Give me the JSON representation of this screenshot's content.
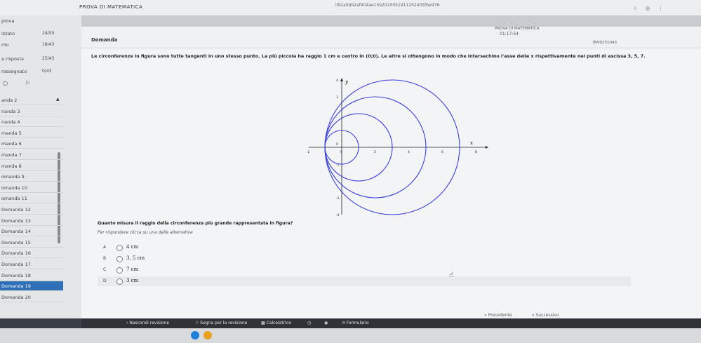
{
  "app": {
    "title": "PROVA DI MATEMATICA",
    "url": "lI92a5bb2af904ae15b2025051911252405fbe976"
  },
  "sidebar": {
    "title": "prova",
    "stats": [
      {
        "label": "izzato",
        "count": "24/50"
      },
      {
        "label": "nto",
        "count": "18/43"
      },
      {
        "label": "a risposta",
        "count": "25/43"
      },
      {
        "label": "rassegnato",
        "count": "0/43"
      }
    ],
    "questions": [
      "anda 2",
      "nanda 3",
      "nanda 4",
      "manda 5",
      "manda 6",
      "manda 7",
      "manda 8",
      "omanda 9",
      "omanda 10",
      "omanda 11",
      "Domanda 12",
      "Domanda 13",
      "Domanda 14",
      "Domanda 15",
      "Domanda 16",
      "Domanda 17",
      "Domanda 18",
      "Domanda 19",
      "Domanda 20"
    ],
    "active_index": 17
  },
  "header": {
    "heading": "Domanda",
    "exam_name": "PROVA DI MATEMATICA",
    "timer": "01:17:54",
    "user": "INV0251043"
  },
  "question": {
    "text": "Le circonferenze in figura sono tutte tangenti in uno stesso punto. La più piccola ha raggio 1 cm e centro in (0;0). Le altre si ottengono in modo che intersechino l'asse delle x rispettivamente nei punti di ascissa 3, 5, 7.",
    "prompt": "Quanto misura il raggio della circonferenza più grande rappresentata in figura?",
    "instruction": "Per rispondere clicca su una delle alternative",
    "options": [
      {
        "letter": "A",
        "value": "4 cm"
      },
      {
        "letter": "B",
        "value": "3, 5 cm"
      },
      {
        "letter": "C",
        "value": "7 cm"
      },
      {
        "letter": "D",
        "value": "3 cm"
      }
    ]
  },
  "graph": {
    "y_label": "y",
    "x_label": "x",
    "x_ticks": [
      "-2",
      "0",
      "2",
      "4",
      "6",
      "8"
    ],
    "y_ticks": [
      "4",
      "3",
      "0",
      "-1",
      "-3",
      "-4"
    ]
  },
  "bottom": {
    "left_label": "Nascondi revisione",
    "mark_label": "Segna per la revisione",
    "calc_label": "Calcolatrice",
    "formula_label": "Formulario",
    "prev_label": "Precedente",
    "next_label": "Successivo"
  },
  "colors": {
    "accent": "#2f6fb6",
    "circle": "#3a3fd9"
  }
}
